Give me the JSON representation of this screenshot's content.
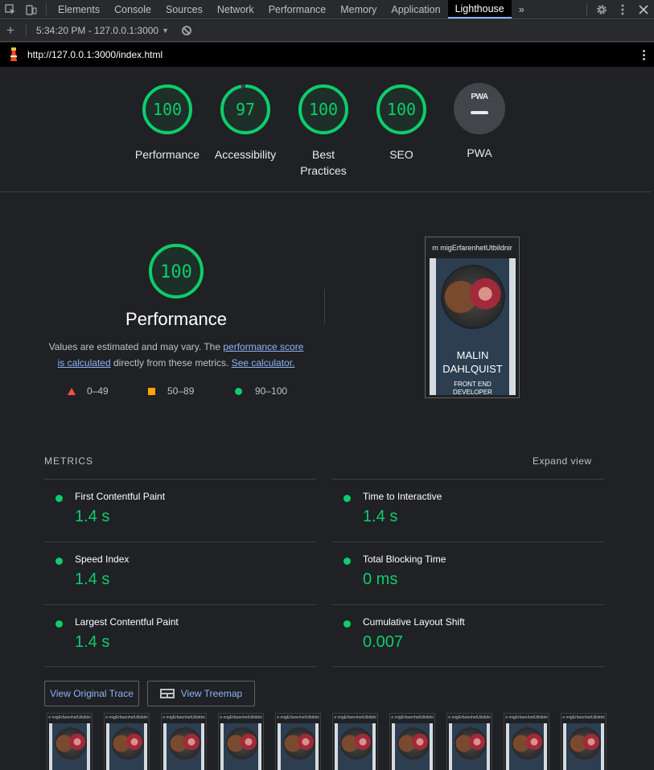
{
  "devtools": {
    "tabs": [
      {
        "label": "Elements"
      },
      {
        "label": "Console"
      },
      {
        "label": "Sources"
      },
      {
        "label": "Network"
      },
      {
        "label": "Performance"
      },
      {
        "label": "Memory"
      },
      {
        "label": "Application"
      },
      {
        "label": "Lighthouse",
        "active": true
      }
    ],
    "overflow_glyph": "»",
    "report_selector": "5:34:20 PM - 127.0.0.1:3000",
    "url": "http://127.0.0.1:3000/index.html"
  },
  "categories": [
    {
      "label": "Performance",
      "score": "100",
      "fraction": 1.0
    },
    {
      "label": "Accessibility",
      "score": "97",
      "fraction": 0.97
    },
    {
      "label": "Best Practices",
      "score": "100",
      "fraction": 1.0
    },
    {
      "label": "SEO",
      "score": "100",
      "fraction": 1.0
    },
    {
      "label": "PWA",
      "badge": "PWA"
    }
  ],
  "performance": {
    "score": "100",
    "title": "Performance",
    "desc_prefix": "Values are estimated and may vary. The ",
    "desc_link1": "performance score is calculated",
    "desc_middle": " directly from these metrics. ",
    "desc_link2": "See calculator.",
    "legend": [
      {
        "range": "0–49",
        "color": "#ff4e42"
      },
      {
        "range": "50–89",
        "color": "#ffa400"
      },
      {
        "range": "90–100",
        "color": "#0cce6b"
      }
    ],
    "final_screenshot": {
      "header": "m migErfarenhetUtbildnir",
      "name": "MALIN DAHLQUIST",
      "role": "FRONT END DEVELOPER"
    }
  },
  "metrics": {
    "title": "METRICS",
    "expand_label": "Expand view",
    "items": [
      {
        "label": "First Contentful Paint",
        "value": "1.4 s"
      },
      {
        "label": "Time to Interactive",
        "value": "1.4 s"
      },
      {
        "label": "Speed Index",
        "value": "1.4 s"
      },
      {
        "label": "Total Blocking Time",
        "value": "0 ms"
      },
      {
        "label": "Largest Contentful Paint",
        "value": "1.4 s"
      },
      {
        "label": "Cumulative Layout Shift",
        "value": "0.007"
      }
    ]
  },
  "buttons": {
    "view_trace": "View Original Trace",
    "view_treemap": "View Treemap"
  },
  "filmstrip": {
    "frame_header": "e migErfarenhetUtbildni",
    "frame_count": 10
  },
  "colors": {
    "pass": "#0cce6b",
    "link": "#8ab4f8",
    "background": "#202124"
  }
}
